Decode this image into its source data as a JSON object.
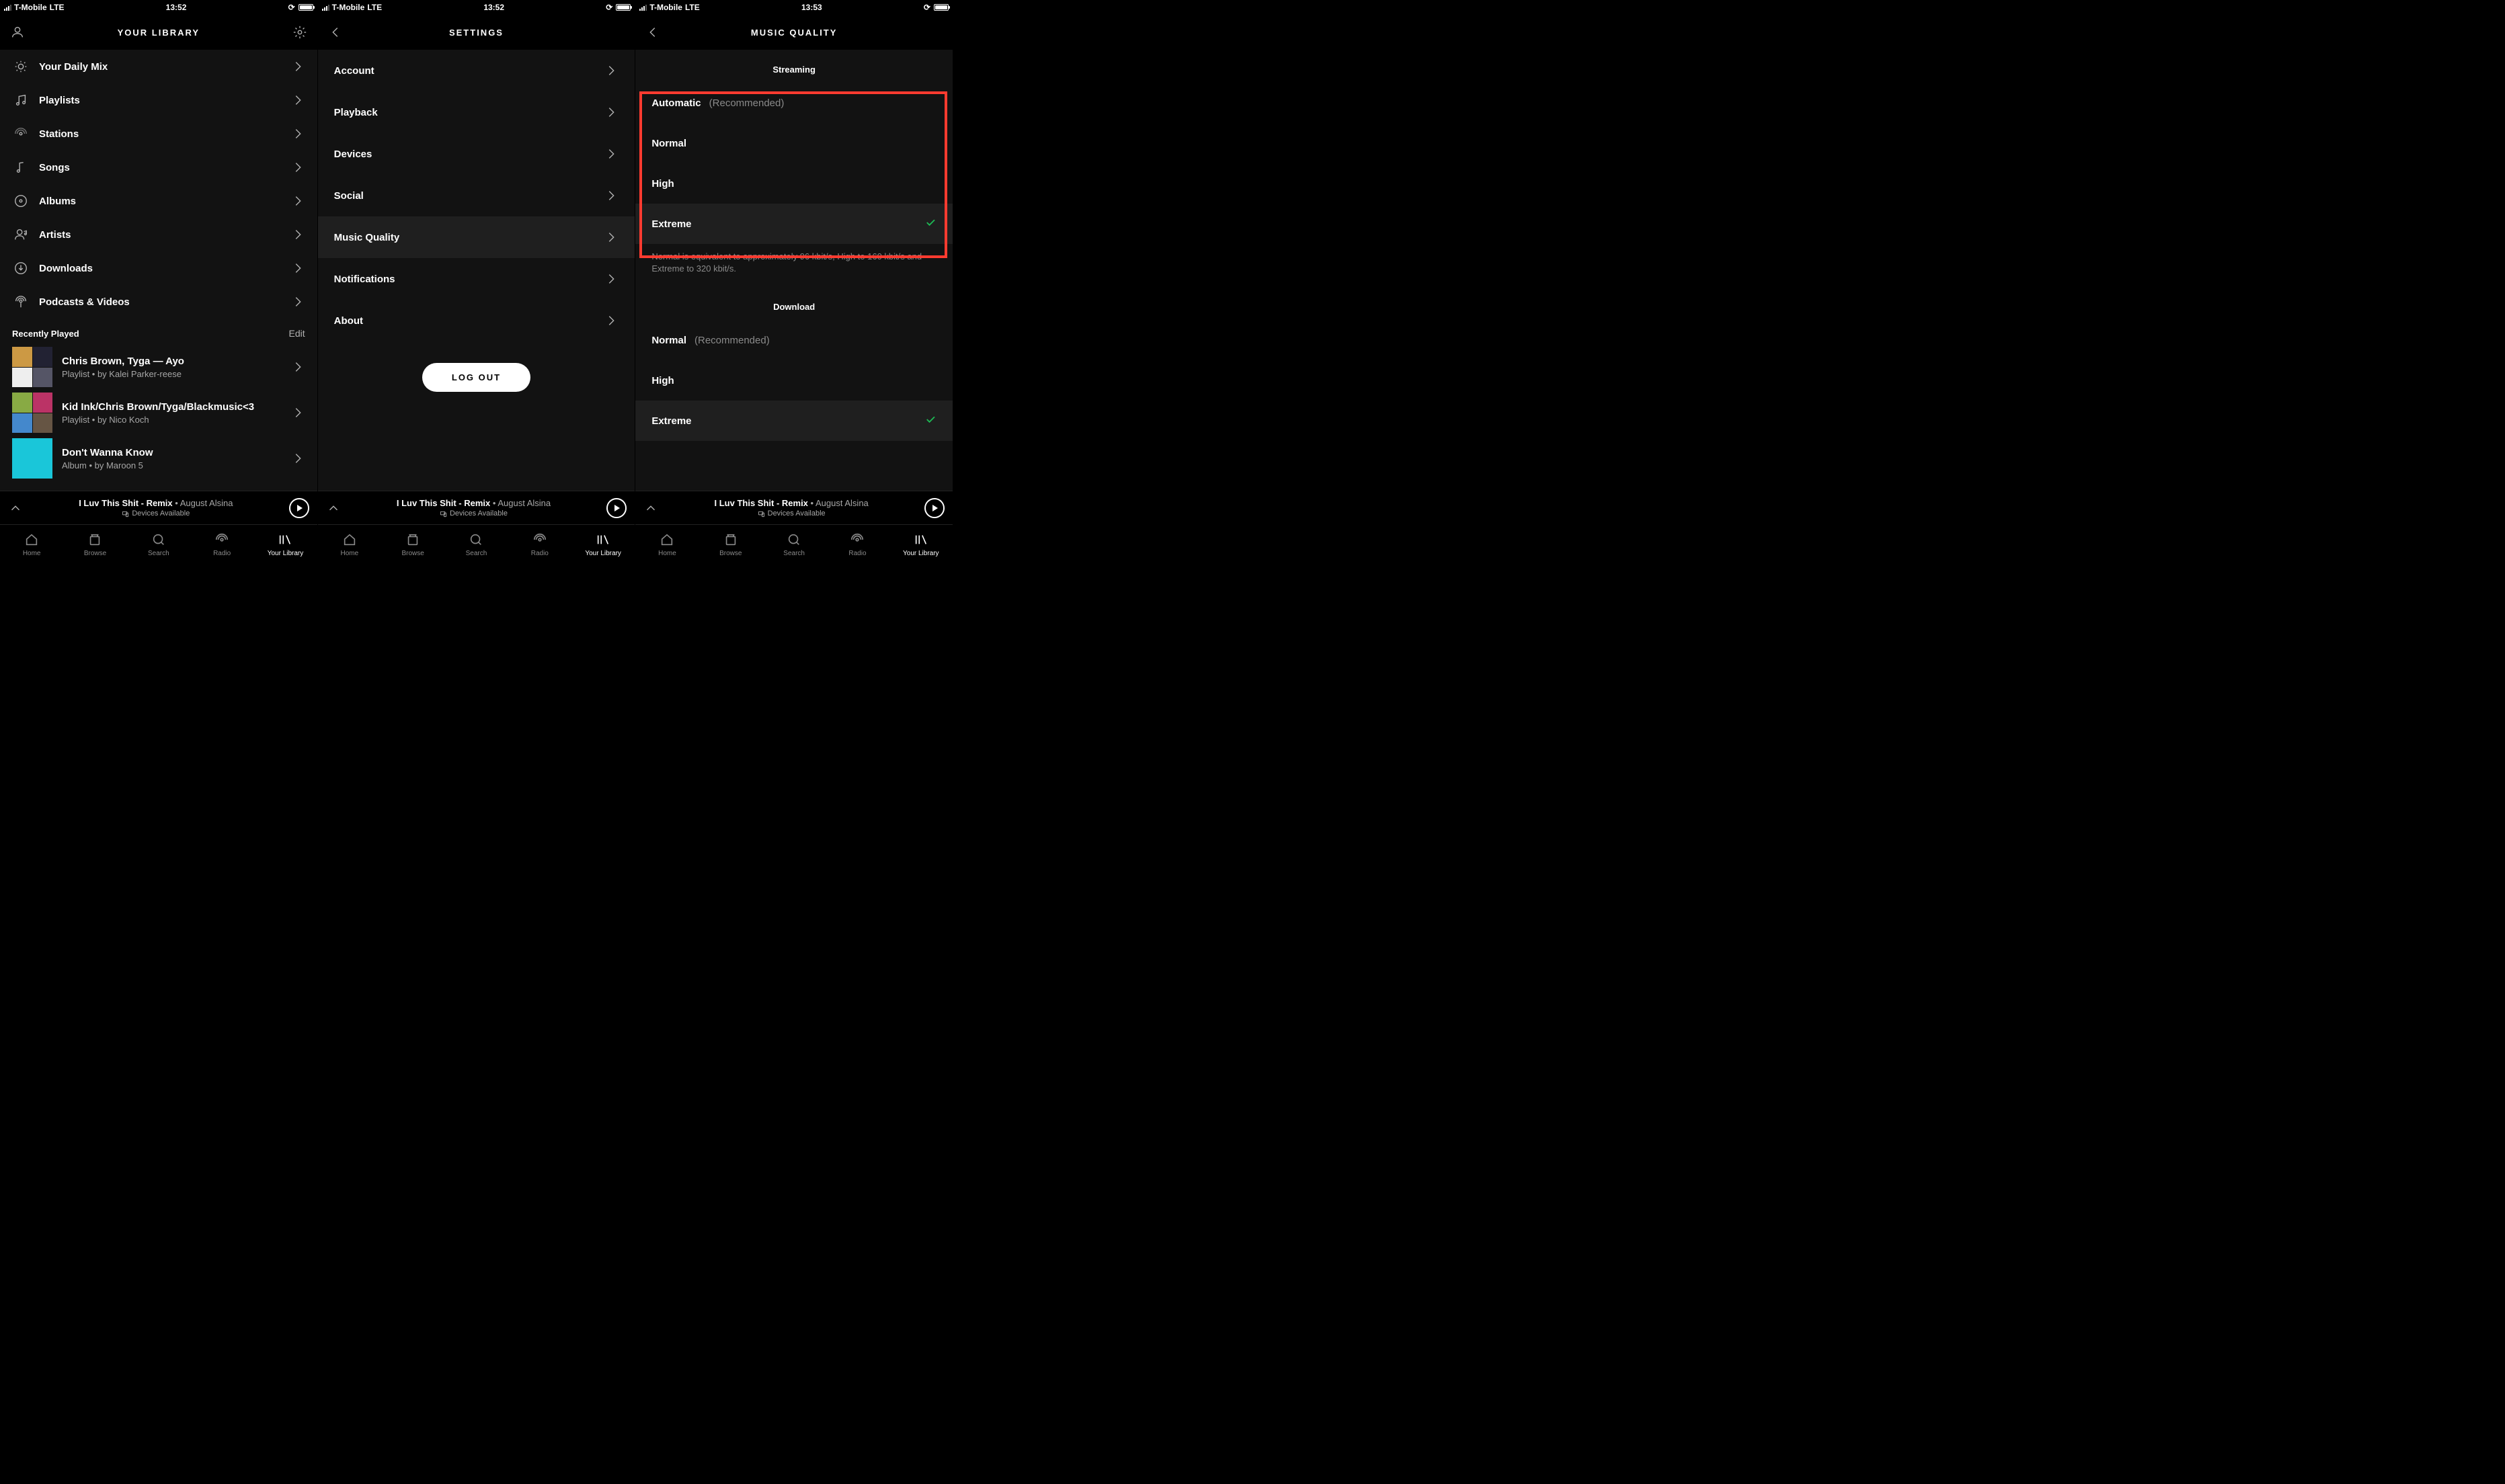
{
  "status": {
    "carrier": "T-Mobile",
    "network": "LTE",
    "time12": "13:52",
    "time3": "13:53"
  },
  "panel1": {
    "title": "YOUR LIBRARY",
    "items": [
      {
        "icon": "sun",
        "label": "Your Daily Mix"
      },
      {
        "icon": "note",
        "label": "Playlists"
      },
      {
        "icon": "broadcast",
        "label": "Stations"
      },
      {
        "icon": "note2",
        "label": "Songs"
      },
      {
        "icon": "disc",
        "label": "Albums"
      },
      {
        "icon": "artist",
        "label": "Artists"
      },
      {
        "icon": "download",
        "label": "Downloads"
      },
      {
        "icon": "podcast",
        "label": "Podcasts & Videos"
      }
    ],
    "recentTitle": "Recently Played",
    "editLabel": "Edit",
    "recent": [
      {
        "title": "Chris Brown, Tyga — Ayo",
        "sub": "Playlist • by Kalei Parker-reese"
      },
      {
        "title": "Kid Ink/Chris Brown/Tyga/Blackmusic<3",
        "sub": "Playlist • by Nico Koch"
      },
      {
        "title": "Don't Wanna Know",
        "sub": "Album • by Maroon 5"
      }
    ]
  },
  "panel2": {
    "title": "SETTINGS",
    "items": [
      "Account",
      "Playback",
      "Devices",
      "Social",
      "Music Quality",
      "Notifications",
      "About"
    ],
    "hlIndex": 4,
    "logout": "LOG OUT"
  },
  "panel3": {
    "title": "MUSIC QUALITY",
    "streaming": {
      "header": "Streaming",
      "options": [
        {
          "label": "Automatic",
          "hint": "(Recommended)"
        },
        {
          "label": "Normal"
        },
        {
          "label": "High"
        },
        {
          "label": "Extreme",
          "checked": true
        }
      ],
      "note": "Normal is equivalent to approximately 96 kbit/s, High to 160 kbit/s and Extreme to 320 kbit/s."
    },
    "download": {
      "header": "Download",
      "options": [
        {
          "label": "Normal",
          "hint": "(Recommended)"
        },
        {
          "label": "High"
        },
        {
          "label": "Extreme",
          "checked": true
        }
      ]
    }
  },
  "nowplaying": {
    "track": "I Luv This Shit - Remix",
    "artist": "August Alsina",
    "devices": "Devices Available"
  },
  "tabs": [
    "Home",
    "Browse",
    "Search",
    "Radio",
    "Your Library"
  ],
  "activeTab": 4
}
